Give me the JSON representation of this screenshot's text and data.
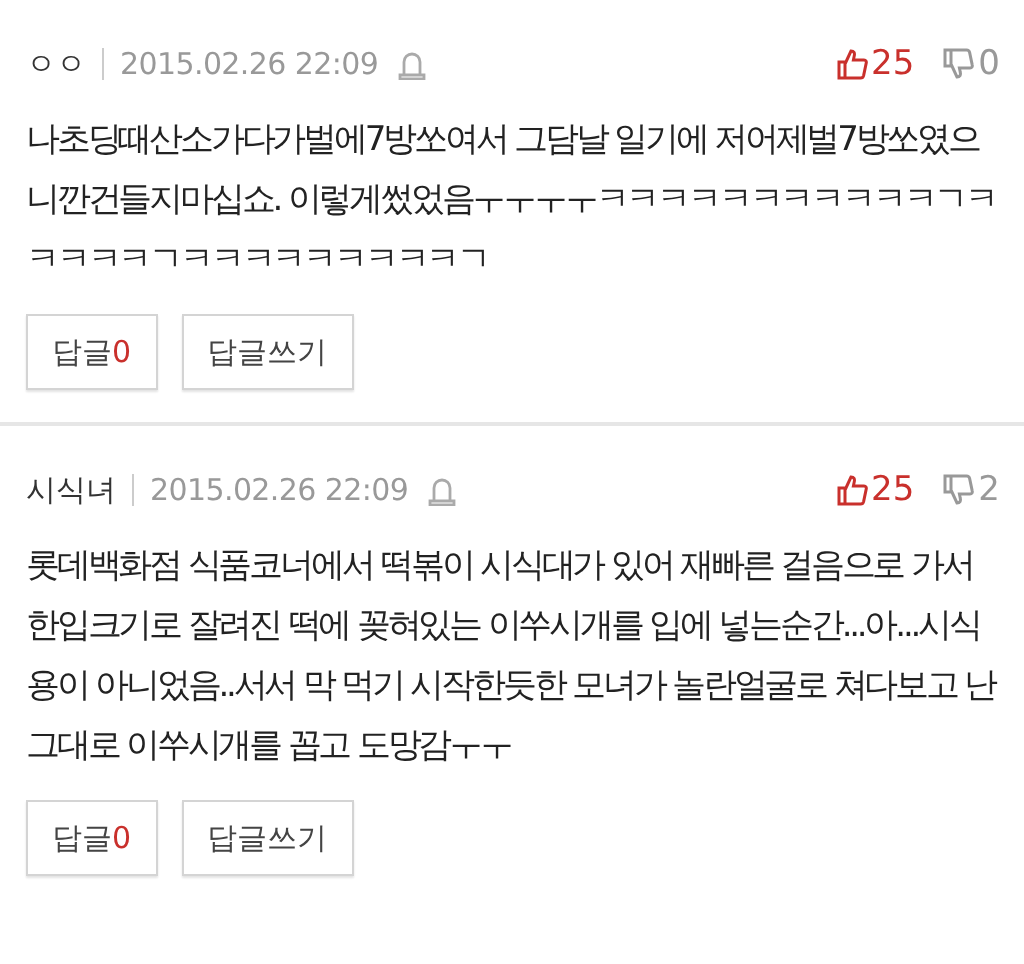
{
  "comments": [
    {
      "author": "ㅇㅇ",
      "date": "2015.02.26 22:09",
      "likes": "25",
      "dislikes": "0",
      "body": "나초딩때산소가다가벌에7방쏘여서 그담날 일기에 저어제벌7방쏘였으니깐건들지마십쇼. 이렇게썼었음ㅜㅜㅜㅜㅋㅋㅋㅋㅋㅋㅋㅋㅋㅋㅋㄱㅋㅋㅋㅋㅋㄱㅋㅋㅋㅋㅋㅋㅋㅋㅋㄱ",
      "reply_label": "답글",
      "reply_count": "0",
      "write_reply": "답글쓰기"
    },
    {
      "author": "시식녀",
      "date": "2015.02.26 22:09",
      "likes": "25",
      "dislikes": "2",
      "body": "롯데백화점 식품코너에서 떡볶이 시식대가 있어 재빠른 걸음으로 가서 한입크기로 잘려진 떡에 꽂혀있는 이쑤시개를 입에 넣는순간...아...시식용이 아니었음..서서 막 먹기 시작한듯한 모녀가 놀란얼굴로 쳐다보고 난 그대로 이쑤시개를 꼽고 도망감ㅜㅜ",
      "reply_label": "답글",
      "reply_count": "0",
      "write_reply": "답글쓰기"
    }
  ]
}
